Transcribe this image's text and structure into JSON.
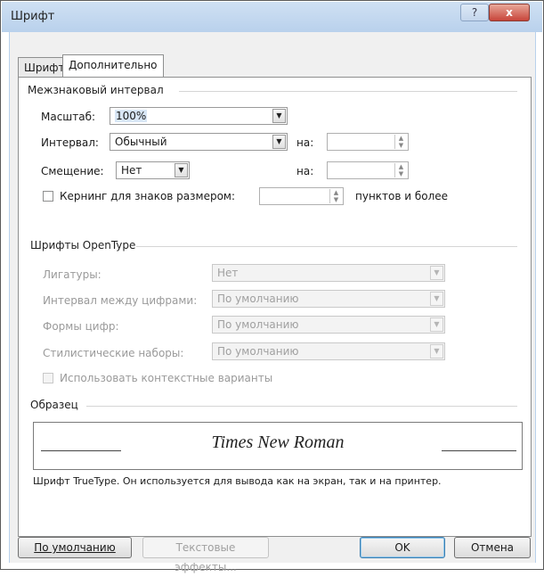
{
  "window": {
    "title": "Шрифт",
    "help_button": "?",
    "close_button": "x"
  },
  "tabs": [
    {
      "label": "Шрифт",
      "active": false
    },
    {
      "label": "Дополнительно",
      "active": true
    }
  ],
  "spacing_group": {
    "title": "Межзнаковый интервал",
    "scale_label": "Масштаб:",
    "scale_value": "100%",
    "spacing_label": "Интервал:",
    "spacing_value": "Обычный",
    "spacing_on_label": "на:",
    "spacing_on_value": "",
    "position_label": "Смещение:",
    "position_value": "Нет",
    "position_on_label": "на:",
    "position_on_value": "",
    "kerning_label": "Кернинг для знаков размером:",
    "kerning_checked": false,
    "kerning_value": "",
    "kerning_suffix": "пунктов и более"
  },
  "opentype_group": {
    "title": "Шрифты OpenType",
    "ligatures_label": "Лигатуры:",
    "ligatures_value": "Нет",
    "number_spacing_label": "Интервал между цифрами:",
    "number_spacing_value": "По умолчанию",
    "number_forms_label": "Формы цифр:",
    "number_forms_value": "По умолчанию",
    "stylistic_sets_label": "Стилистические наборы:",
    "stylistic_sets_value": "По умолчанию",
    "contextual_label": "Использовать контекстные варианты",
    "contextual_checked": false
  },
  "preview_group": {
    "title": "Образец",
    "sample_text": "Times New Roman",
    "note": "Шрифт TrueType. Он используется для вывода как на экран, так и на принтер."
  },
  "buttons": {
    "default": "По умолчанию",
    "text_effects": "Текстовые эффекты...",
    "ok": "OK",
    "cancel": "Отмена"
  }
}
